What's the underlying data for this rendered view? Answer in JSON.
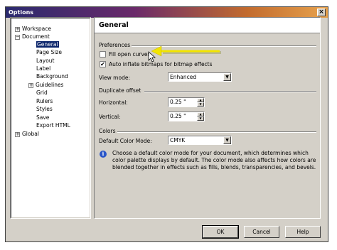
{
  "window": {
    "title": "Options",
    "close_glyph": "×"
  },
  "tree": {
    "items": [
      {
        "label": "Workspace",
        "expander": "+"
      },
      {
        "label": "Document",
        "expander": "−"
      },
      {
        "label": "General"
      },
      {
        "label": "Page Size"
      },
      {
        "label": "Layout"
      },
      {
        "label": "Label"
      },
      {
        "label": "Background"
      },
      {
        "label": "Guidelines",
        "expander": "+"
      },
      {
        "label": "Grid"
      },
      {
        "label": "Rulers"
      },
      {
        "label": "Styles"
      },
      {
        "label": "Save"
      },
      {
        "label": "Export HTML"
      },
      {
        "label": "Global",
        "expander": "+"
      }
    ],
    "selected": "General"
  },
  "panel": {
    "title": "General",
    "preferences": {
      "heading": "Preferences",
      "fill_open_curves": {
        "label": "Fill open curves",
        "checked": false
      },
      "auto_inflate": {
        "label": "Auto inflate bitmaps for bitmap effects",
        "checked": true,
        "mark": "✔"
      },
      "view_mode_label": "View mode:",
      "view_mode_value": "Enhanced"
    },
    "duplicate_offset": {
      "heading": "Duplicate offset",
      "horizontal_label": "Horizontal:",
      "horizontal_value": "0.25 \"",
      "vertical_label": "Vertical:",
      "vertical_value": "0.25 \""
    },
    "colors": {
      "heading": "Colors",
      "default_color_mode_label": "Default Color Mode:",
      "default_color_mode_value": "CMYK",
      "info_glyph": "i",
      "info_text": "Choose a default color mode for your document, which determines which color palette displays by default. The color mode also affects how colors are blended together in effects such as fills, blends, transparencies, and bevels."
    }
  },
  "buttons": {
    "ok": "OK",
    "cancel": "Cancel",
    "help": "Help"
  },
  "icons": {
    "dropdown": "chevron-down-icon",
    "annotation": "yellow-arrow",
    "cursor": "mouse-pointer-icon"
  },
  "colors": {
    "selection": "#0a246a",
    "arrow": "#f2e400",
    "dialog_bg": "#d4d0c8"
  }
}
